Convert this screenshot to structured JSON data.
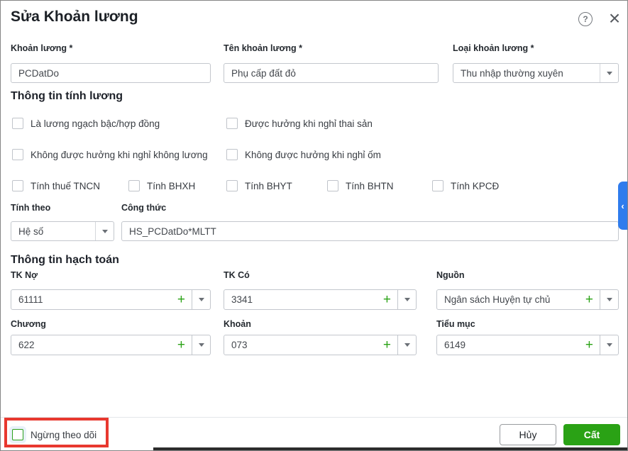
{
  "dialog": {
    "title": "Sửa Khoản lương",
    "header_icons": {
      "help_glyph": "?",
      "close_glyph": "×"
    },
    "top_fields": {
      "code": {
        "label": "Khoản lương *",
        "value": "PCDatDo"
      },
      "name": {
        "label": "Tên khoản lương *",
        "value": "Phụ cấp đất đỏ"
      },
      "type": {
        "label": "Loại khoản lương *",
        "value": "Thu nhập thường xuyên"
      }
    },
    "salary_section": {
      "heading": "Thông tin tính lương",
      "checkboxes": [
        {
          "label": "Là lương ngạch bậc/hợp đồng",
          "checked": false
        },
        {
          "label": "Được hưởng khi nghỉ thai sản",
          "checked": false
        },
        {
          "label": "Không được hưởng khi nghỉ không lương",
          "checked": false
        },
        {
          "label": "Không được hưởng khi nghỉ ốm",
          "checked": false
        },
        {
          "label": "Tính thuế TNCN",
          "checked": false
        },
        {
          "label": "Tính BHXH",
          "checked": false
        },
        {
          "label": "Tính BHYT",
          "checked": false
        },
        {
          "label": "Tính BHTN",
          "checked": false
        },
        {
          "label": "Tính KPCĐ",
          "checked": false
        }
      ],
      "calc_by": {
        "label": "Tính theo",
        "value": "Hệ số"
      },
      "formula": {
        "label": "Công thức",
        "value": "HS_PCDatDo*MLTT"
      }
    },
    "accounting_section": {
      "heading": "Thông tin hạch toán",
      "add_glyph": "+",
      "combos": [
        {
          "label": "TK Nợ",
          "value": "61111"
        },
        {
          "label": "TK Có",
          "value": "3341"
        },
        {
          "label": "Nguồn",
          "value": "Ngân sách Huyện tự chủ"
        },
        {
          "label": "Chương",
          "value": "622"
        },
        {
          "label": "Khoản",
          "value": "073"
        },
        {
          "label": "Tiểu mục",
          "value": "6149"
        }
      ]
    },
    "footer": {
      "stop_tracking": {
        "label": "Ngừng theo dõi",
        "checked": false
      },
      "cancel_label": "Hủy",
      "save_label": "Cất"
    },
    "side_tab": {
      "chevron_glyph": "‹"
    },
    "colors": {
      "primary_green": "#2aa215",
      "annotation_red": "#e8382f",
      "side_tab_blue": "#2f7ced"
    }
  }
}
